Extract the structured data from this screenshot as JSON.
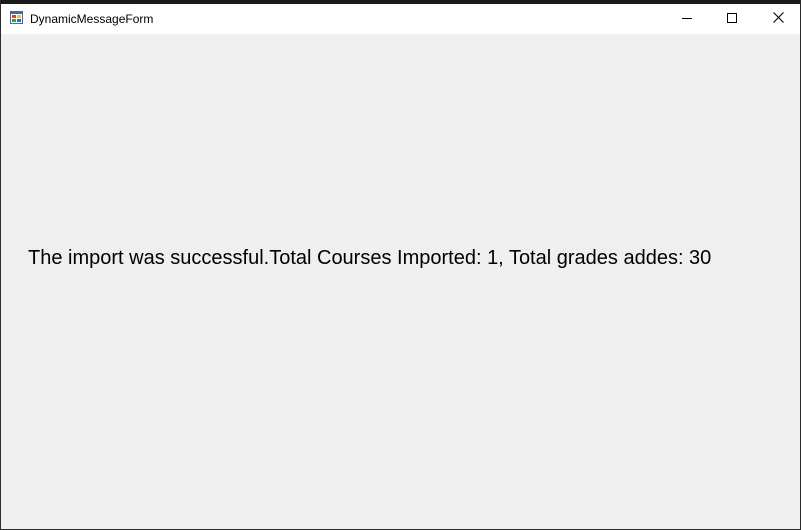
{
  "window": {
    "title": "DynamicMessageForm",
    "icon": "winforms-app-icon",
    "controls": {
      "minimize": "minimize-icon",
      "maximize": "maximize-icon",
      "close": "close-icon"
    }
  },
  "message": {
    "text": "The import was successful.Total Courses Imported: 1, Total grades addes: 30"
  },
  "colors": {
    "background": "#efefef",
    "titlebar": "#ffffff",
    "text": "#000000"
  }
}
